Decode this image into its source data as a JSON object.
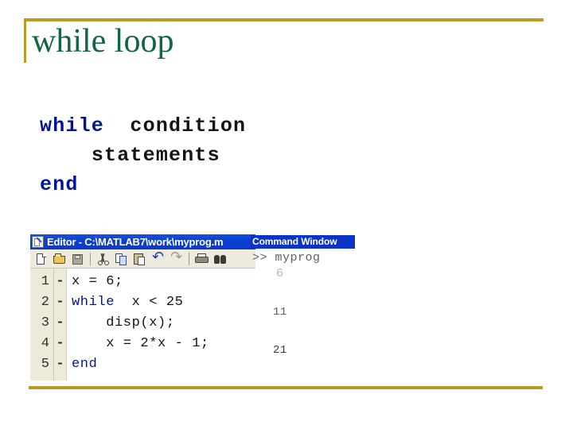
{
  "slide": {
    "title": "while loop",
    "accent_color": "#bd9b22",
    "title_color": "#126442"
  },
  "syntax_template": {
    "lines": [
      {
        "indent": 0,
        "tokens": [
          {
            "text": "while ",
            "kind": "keyword"
          },
          {
            "text": "condition",
            "kind": "plain"
          }
        ]
      },
      {
        "indent": 1,
        "tokens": [
          {
            "text": "statements",
            "kind": "plain"
          }
        ]
      },
      {
        "indent": 0,
        "tokens": [
          {
            "text": "end",
            "kind": "keyword"
          }
        ]
      }
    ],
    "line1_keyword": "while",
    "line1_plain": "condition",
    "line2_plain": "statements",
    "line3_keyword": "end",
    "keyword_color": "#00158f",
    "plain_color": "#141414"
  },
  "editor_window": {
    "title": "Editor - C:\\MATLAB7\\work\\myprog.m",
    "icon": "editor-document-pencil-icon",
    "titlebar_color": "#0b3fd3",
    "toolbar": [
      {
        "name": "new-file-button",
        "label": "New"
      },
      {
        "name": "open-file-button",
        "label": "Open"
      },
      {
        "name": "save-file-button",
        "label": "Save"
      },
      {
        "name": "cut-button",
        "label": "Cut"
      },
      {
        "name": "copy-button",
        "label": "Copy"
      },
      {
        "name": "paste-button",
        "label": "Paste"
      },
      {
        "name": "undo-button",
        "label": "Undo"
      },
      {
        "name": "redo-button",
        "label": "Redo"
      },
      {
        "name": "print-button",
        "label": "Print"
      },
      {
        "name": "find-button",
        "label": "Find"
      }
    ],
    "code": [
      {
        "number": "1",
        "mark": "-",
        "text": "x = 6;",
        "keyword": ""
      },
      {
        "number": "2",
        "mark": "-",
        "text": "  x < 25",
        "keyword": "while"
      },
      {
        "number": "3",
        "mark": "-",
        "text": "    disp(x);",
        "keyword": ""
      },
      {
        "number": "4",
        "mark": "-",
        "text": "    x = 2*x - 1;",
        "keyword": ""
      },
      {
        "number": "5",
        "mark": "-",
        "text": "",
        "keyword": "end"
      }
    ]
  },
  "command_window": {
    "title": "Command Window",
    "titlebar_color": "#0a34c8",
    "prompt_line": ">> myprog",
    "outputs": [
      "6",
      "11",
      "21"
    ]
  }
}
